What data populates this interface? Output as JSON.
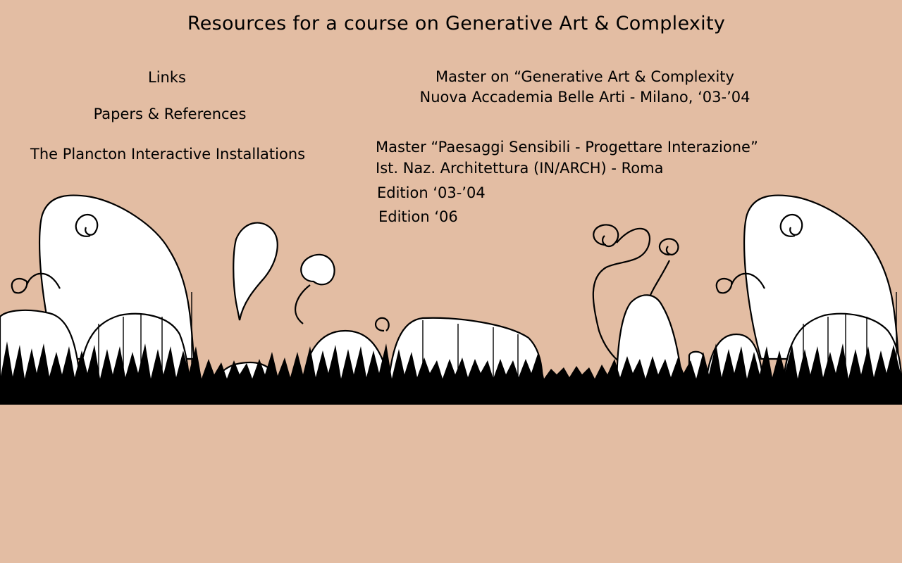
{
  "page": {
    "title": "Resources for a course on Generative Art & Complexity",
    "background_color": "#e3bda3"
  },
  "nav": {
    "links": "Links",
    "papers": "Papers & References",
    "plancton": "The Plancton Interactive Installations"
  },
  "master_milano": {
    "line1": "Master on “Generative Art & Complexity",
    "line2": "Nuova Accademia Belle Arti - Milano, ‘03-’04"
  },
  "master_roma": {
    "line1": "Master “Paesaggi Sensibili - Progettare Interazione”",
    "line2": "Ist. Naz. Architettura (IN/ARCH) - Roma",
    "editions": [
      "Edition  ‘03-’04",
      "Edition ‘06"
    ]
  },
  "decoration": {
    "illustration": "black-and-white hand-drawn organic plant landscape"
  }
}
